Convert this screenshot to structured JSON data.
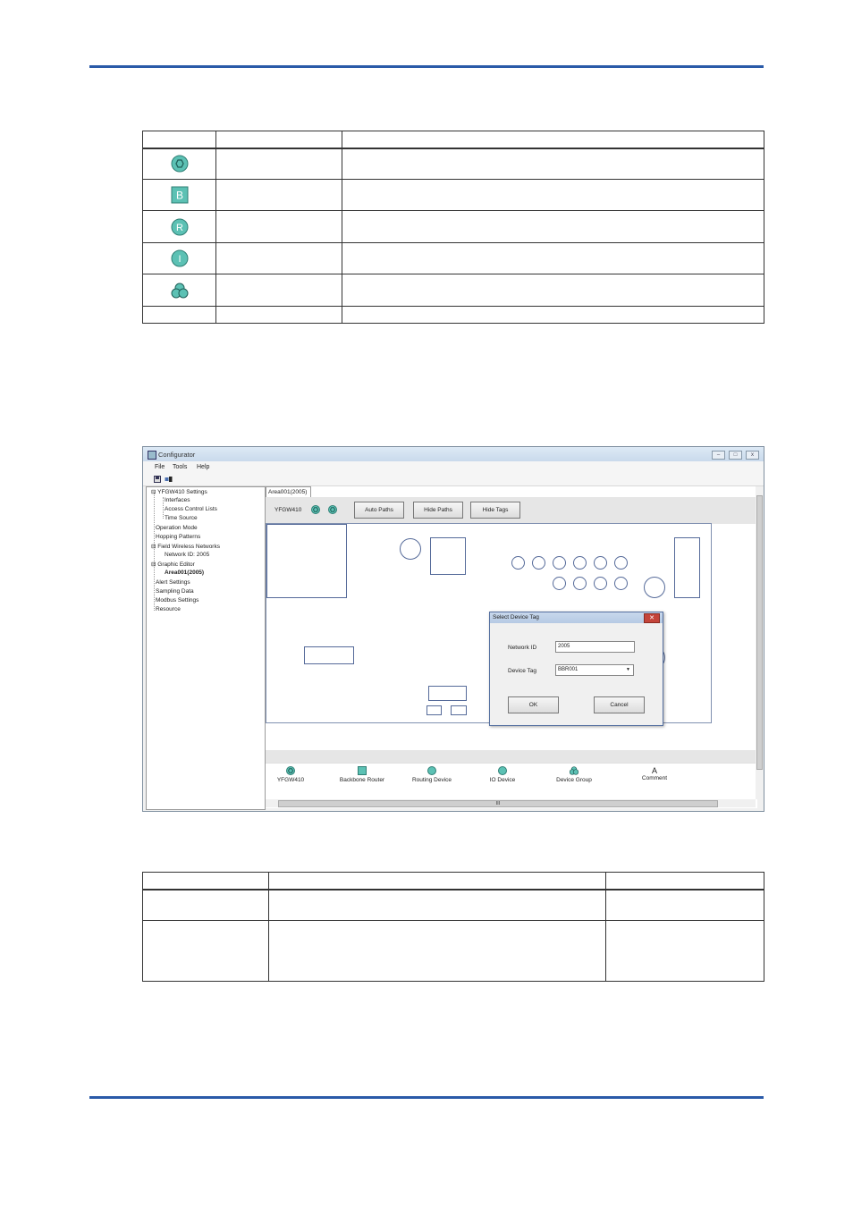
{
  "icon_table": {
    "header": [
      "",
      "",
      ""
    ],
    "rows": [
      {
        "icon": "ygw-gateway-icon",
        "name": "",
        "desc": ""
      },
      {
        "icon": "backbone-router-icon",
        "glyph": "B",
        "name": "",
        "desc": ""
      },
      {
        "icon": "routing-device-icon",
        "glyph": "R",
        "name": "",
        "desc": ""
      },
      {
        "icon": "io-device-icon",
        "glyph": "I",
        "name": "",
        "desc": ""
      },
      {
        "icon": "device-group-icon",
        "name": "",
        "desc": ""
      },
      {
        "icon": "",
        "name": "",
        "desc": ""
      }
    ]
  },
  "app": {
    "title": "Configurator",
    "menu": [
      "File",
      "Tools",
      "Help"
    ],
    "window_buttons": [
      "–",
      "□",
      "x"
    ],
    "tree": [
      "YFGW410 Settings",
      "Interfaces",
      "Access Control Lists",
      "Time Source",
      "Operation Mode",
      "Hopping Patterns",
      "Field Wireless Networks",
      "Network ID: 2005",
      "Graphic Editor",
      "Area001(2005)",
      "Alert Settings",
      "Sampling Data",
      "Modbus Settings",
      "Resource"
    ],
    "tab_label": "Area001(2005)",
    "gateway_label": "YFGW410",
    "buttons": {
      "auto_paths": "Auto Paths",
      "hide_paths": "Hide Paths",
      "hide_tags": "Hide Tags"
    },
    "palette": [
      "YFGW410",
      "Backbone Router",
      "Routing Device",
      "IO Device",
      "Device Group",
      "Comment"
    ],
    "palette_comment_glyph": "A",
    "dialog": {
      "title": "Select Device Tag",
      "network_id_label": "Network ID",
      "network_id_value": "2005",
      "device_tag_label": "Device Tag",
      "device_tag_value": "BBR001",
      "ok": "OK",
      "cancel": "Cancel"
    },
    "scroll_mark": "III",
    "accent_color": "#5cc1b4"
  },
  "bottom_table": {
    "header": [
      "",
      "",
      ""
    ],
    "rows": [
      [
        "",
        "",
        ""
      ],
      [
        "",
        "",
        ""
      ]
    ]
  }
}
